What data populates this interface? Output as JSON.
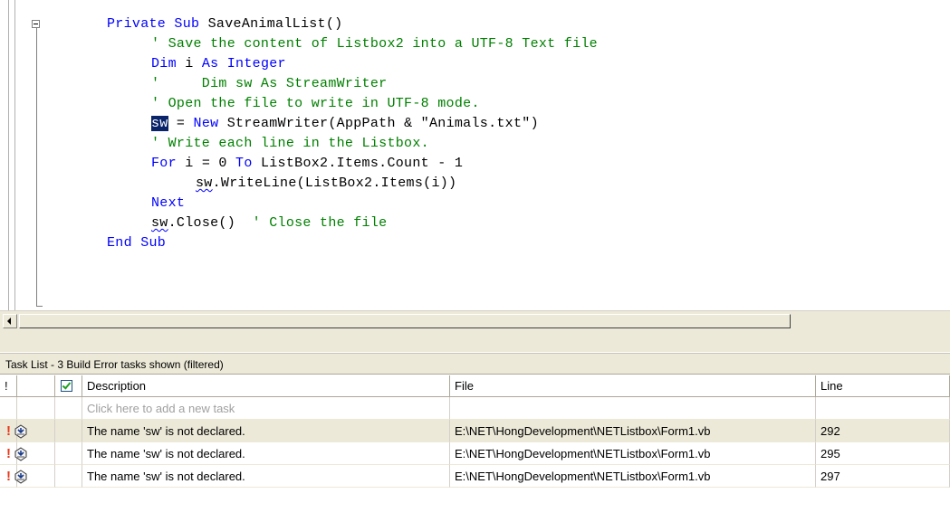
{
  "editor": {
    "lines": [
      {
        "i": 0,
        "parts": [
          {
            "c": "kw",
            "t": "Private Sub "
          },
          {
            "c": "tx",
            "t": "SaveAnimalList()"
          }
        ]
      },
      {
        "i": 1,
        "parts": [
          {
            "c": "cm",
            "t": "' Save the content of Listbox2 into a UTF-8 Text file"
          }
        ]
      },
      {
        "i": 1,
        "parts": [
          {
            "c": "kw",
            "t": "Dim "
          },
          {
            "c": "tx",
            "t": "i "
          },
          {
            "c": "kw",
            "t": "As Integer"
          }
        ]
      },
      {
        "i": 1,
        "parts": [
          {
            "c": "cm",
            "t": "'     Dim sw As StreamWriter"
          }
        ]
      },
      {
        "i": 1,
        "parts": [
          {
            "c": "cm",
            "t": "' Open the file to write in UTF-8 mode."
          }
        ]
      },
      {
        "i": 1,
        "parts": [
          {
            "c": "sel",
            "t": "sw"
          },
          {
            "c": "tx",
            "t": " = "
          },
          {
            "c": "kw",
            "t": "New "
          },
          {
            "c": "tx",
            "t": "StreamWriter(AppPath & \"Animals.txt\")"
          }
        ]
      },
      {
        "i": 1,
        "parts": [
          {
            "c": "cm",
            "t": "' Write each line in the Listbox."
          }
        ]
      },
      {
        "i": 1,
        "parts": [
          {
            "c": "kw",
            "t": "For "
          },
          {
            "c": "tx",
            "t": "i = 0 "
          },
          {
            "c": "kw",
            "t": "To "
          },
          {
            "c": "tx",
            "t": "ListBox2.Items.Count - 1"
          }
        ]
      },
      {
        "i": 2,
        "parts": [
          {
            "c": "squig",
            "t": "sw"
          },
          {
            "c": "tx",
            "t": ".WriteLine(ListBox2.Items(i))"
          }
        ]
      },
      {
        "i": 1,
        "parts": [
          {
            "c": "kw",
            "t": "Next"
          }
        ]
      },
      {
        "i": 1,
        "parts": [
          {
            "c": "squig",
            "t": "sw"
          },
          {
            "c": "tx",
            "t": ".Close()  "
          },
          {
            "c": "cm",
            "t": "' Close the file"
          }
        ]
      },
      {
        "i": 0,
        "parts": [
          {
            "c": "kw",
            "t": "End Sub"
          }
        ]
      }
    ]
  },
  "task_list": {
    "title": "Task List - 3 Build Error tasks shown (filtered)",
    "columns": {
      "priority": "!",
      "description": "Description",
      "file": "File",
      "line": "Line"
    },
    "new_task_placeholder": "Click here to add a new task",
    "rows": [
      {
        "description": "The name 'sw' is not declared.",
        "file": "E:\\NET\\HongDevelopment\\NETListbox\\Form1.vb",
        "line": "292"
      },
      {
        "description": "The name 'sw' is not declared.",
        "file": "E:\\NET\\HongDevelopment\\NETListbox\\Form1.vb",
        "line": "295"
      },
      {
        "description": "The name 'sw' is not declared.",
        "file": "E:\\NET\\HongDevelopment\\NETListbox\\Form1.vb",
        "line": "297"
      }
    ],
    "icons": {
      "error_mark": "!",
      "row_icon": "build-error-icon",
      "header_check": "checkbox-checked-icon"
    }
  },
  "colors": {
    "keyword": "#0000ff",
    "comment": "#008000",
    "selection": "#0a246a",
    "error": "#e8391b"
  }
}
